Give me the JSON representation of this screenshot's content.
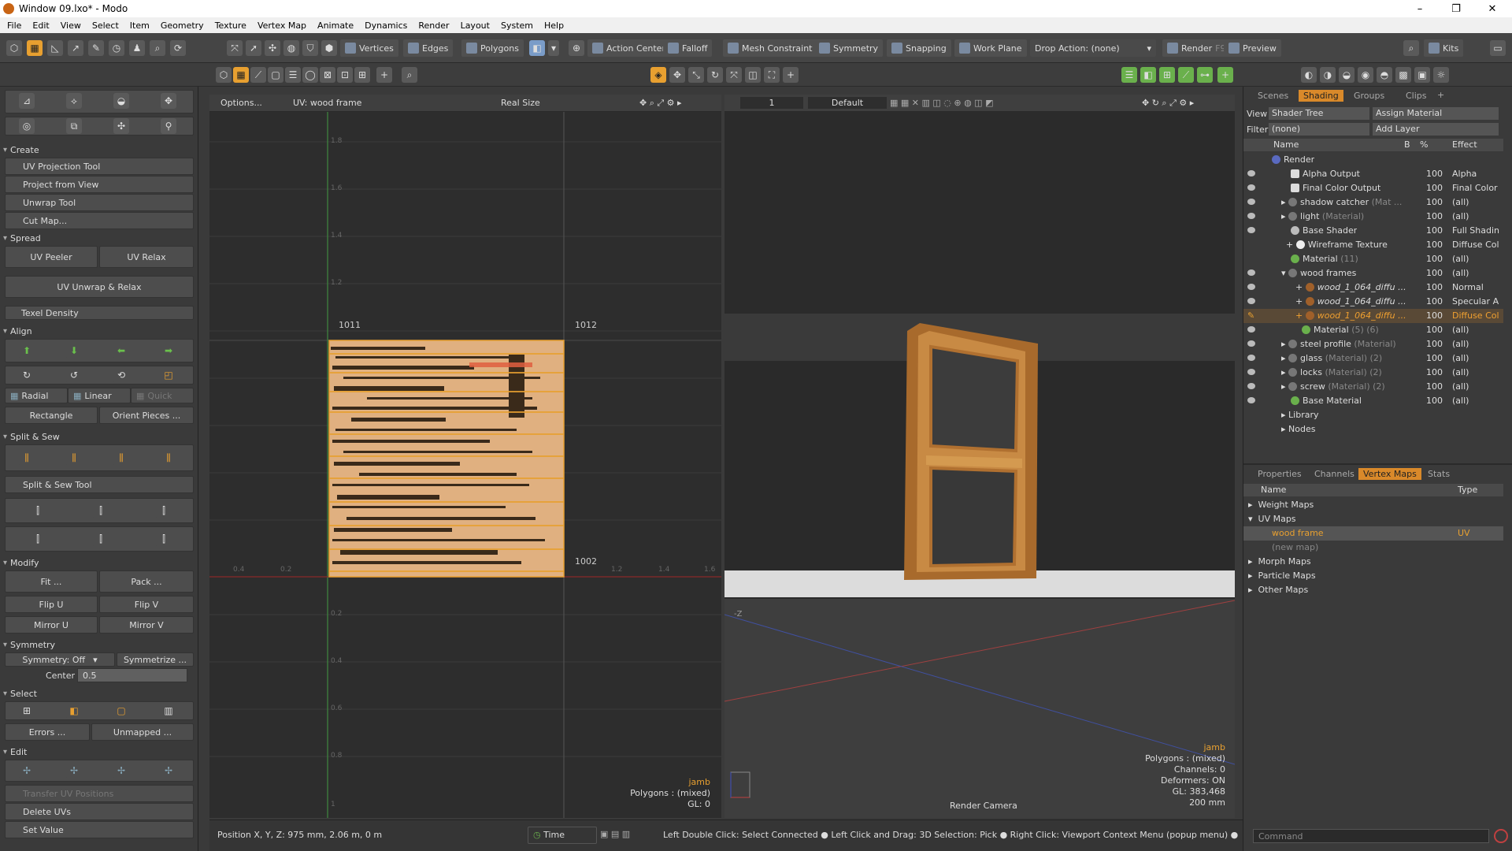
{
  "window": {
    "title": "Window 09.lxo* - Modo",
    "min": "–",
    "max": "❐",
    "close": "✕"
  },
  "menu": [
    "File",
    "Edit",
    "View",
    "Select",
    "Item",
    "Geometry",
    "Texture",
    "Vertex Map",
    "Animate",
    "Dynamics",
    "Render",
    "Layout",
    "System",
    "Help"
  ],
  "toolbar": {
    "vertices": "Vertices",
    "edges": "Edges",
    "polygons": "Polygons",
    "action_center": "Action Center",
    "falloff": "Falloff",
    "mesh_constraint": "Mesh Constraint",
    "symmetry": "Symmetry",
    "snapping": "Snapping",
    "work_plane": "Work Plane",
    "drop_action": "Drop Action: (none)",
    "render": "Render",
    "render_key": "F9",
    "preview": "Preview",
    "kits": "Kits"
  },
  "left_panel": {
    "create": "Create",
    "uv_projection_tool": "UV Projection Tool",
    "project_from_view": "Project from View",
    "unwrap_tool": "Unwrap Tool",
    "cut_map": "Cut Map...",
    "spread": "Spread",
    "uv_peeler": "UV Peeler",
    "uv_relax": "UV Relax",
    "uv_unwrap_relax": "UV Unwrap & Relax",
    "texel_density": "Texel Density",
    "align": "Align",
    "radial": "Radial",
    "linear": "Linear",
    "quick": "Quick",
    "rectangle": "Rectangle",
    "orient_pieces": "Orient Pieces ...",
    "split_sew": "Split & Sew",
    "split_sew_tool": "Split & Sew Tool",
    "modify": "Modify",
    "fit": "Fit ...",
    "pack": "Pack ...",
    "flip_u": "Flip U",
    "flip_v": "Flip V",
    "mirror_u": "Mirror U",
    "mirror_v": "Mirror V",
    "symmetry": "Symmetry",
    "symmetry_off": "Symmetry: Off",
    "symmetrize": "Symmetrize ...",
    "center_label": "Center",
    "center_value": "0.5",
    "select": "Select",
    "errors": "Errors ...",
    "unmapped": "Unmapped ...",
    "edit": "Edit",
    "transfer_uv": "Transfer UV Positions",
    "delete_uvs": "Delete UVs",
    "set_value": "Set Value"
  },
  "uv_view": {
    "options": "Options...",
    "uv_label": "UV: wood frame",
    "real_size": "Real Size",
    "tile_1011": "1011",
    "tile_1012": "1012",
    "tile_1002": "1002",
    "yticks": [
      "1.8",
      "1.6",
      "1.4",
      "1.2"
    ],
    "yticks_neg": [
      "0.2",
      "0.4",
      "0.6",
      "0.8",
      "1"
    ],
    "xticks": [
      "0.4",
      "0.2",
      "1.2",
      "1.4",
      "1.6"
    ],
    "info_item": "jamb",
    "info_polys": "Polygons : (mixed)",
    "info_gl": "GL: 0"
  },
  "view3d": {
    "frame": "1",
    "preset": "Default",
    "info_item": "jamb",
    "info_polys": "Polygons : (mixed)",
    "info_channels": "Channels: 0",
    "info_deformers": "Deformers: ON",
    "info_gl": "GL: 383,468",
    "info_size": "200 mm",
    "camera": "Render Camera",
    "axis_z": "-Z"
  },
  "shading": {
    "tabs": [
      "Scenes",
      "Shading",
      "Groups",
      "Clips"
    ],
    "view_label": "View",
    "view_value": "Shader Tree",
    "assign_material": "Assign Material",
    "filter_label": "Filter",
    "filter_value": "(none)",
    "add_layer": "Add Layer",
    "col_name": "Name",
    "col_b": "B",
    "col_pct": "%",
    "col_effect": "Effect",
    "rows": [
      {
        "name": "Render",
        "sub": "",
        "pct": "",
        "effect": ""
      },
      {
        "name": "Alpha Output",
        "sub": "",
        "pct": "100",
        "effect": "Alpha"
      },
      {
        "name": "Final Color Output",
        "sub": "",
        "pct": "100",
        "effect": "Final Color"
      },
      {
        "name": "shadow catcher",
        "sub": "(Mat ...",
        "pct": "100",
        "effect": "(all)"
      },
      {
        "name": "light",
        "sub": "(Material)",
        "pct": "100",
        "effect": "(all)"
      },
      {
        "name": "Base Shader",
        "sub": "",
        "pct": "100",
        "effect": "Full Shading"
      },
      {
        "name": "Wireframe Texture",
        "sub": "",
        "pct": "100",
        "effect": "Diffuse Color"
      },
      {
        "name": "Material",
        "sub": "(11)",
        "pct": "100",
        "effect": "(all)"
      },
      {
        "name": "wood frames",
        "sub": "",
        "pct": "100",
        "effect": "(all)"
      },
      {
        "name": "wood_1_064_diffu ...",
        "sub": "",
        "pct": "100",
        "effect": "Normal"
      },
      {
        "name": "wood_1_064_diffu ...",
        "sub": "",
        "pct": "100",
        "effect": "Specular Amount"
      },
      {
        "name": "wood_1_064_diffu ...",
        "sub": "",
        "pct": "100",
        "effect": "Diffuse Color"
      },
      {
        "name": "Material",
        "sub": "(5) (6)",
        "pct": "100",
        "effect": "(all)"
      },
      {
        "name": "steel profile",
        "sub": "(Material)",
        "pct": "100",
        "effect": "(all)"
      },
      {
        "name": "glass",
        "sub": "(Material) (2)",
        "pct": "100",
        "effect": "(all)"
      },
      {
        "name": "locks",
        "sub": "(Material) (2)",
        "pct": "100",
        "effect": "(all)"
      },
      {
        "name": "screw",
        "sub": "(Material) (2)",
        "pct": "100",
        "effect": "(all)"
      },
      {
        "name": "Base Material",
        "sub": "",
        "pct": "100",
        "effect": "(all)"
      },
      {
        "name": "Library",
        "sub": "",
        "pct": "",
        "effect": ""
      },
      {
        "name": "Nodes",
        "sub": "",
        "pct": "",
        "effect": ""
      }
    ]
  },
  "vmaps": {
    "tabs": [
      "Properties",
      "Channels",
      "Vertex Maps",
      "Stats"
    ],
    "col_name": "Name",
    "col_type": "Type",
    "weight": "Weight Maps",
    "uv": "UV Maps",
    "uv_item": "wood frame",
    "uv_type": "UV",
    "new_map": "(new map)",
    "morph": "Morph Maps",
    "particle": "Particle Maps",
    "other": "Other Maps"
  },
  "status": {
    "position": "Position X, Y, Z:  975 mm, 2.06 m, 0 m",
    "time": "Time",
    "hints": "Left Double Click: Select Connected ● Left Click and Drag: 3D Selection: Pick ● Right Click: Viewport Context Menu (popup menu) ● Right Click and ...",
    "command_placeholder": "Command"
  }
}
